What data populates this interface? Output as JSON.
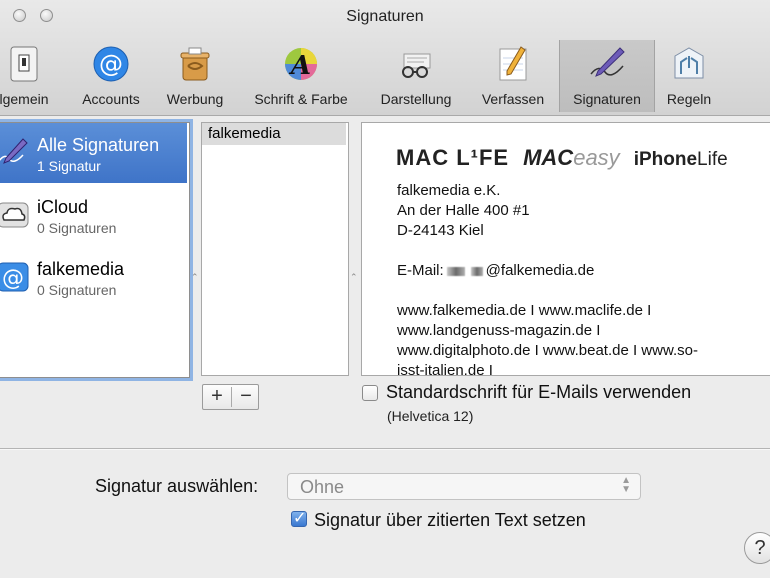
{
  "window": {
    "title": "Signaturen"
  },
  "toolbar": {
    "items": [
      {
        "label": "lgemein",
        "icon": "switch-icon"
      },
      {
        "label": "Accounts",
        "icon": "at-icon"
      },
      {
        "label": "Werbung",
        "icon": "trash-bin-icon"
      },
      {
        "label": "Schrift & Farbe",
        "icon": "font-color-icon"
      },
      {
        "label": "Darstellung",
        "icon": "glasses-icon"
      },
      {
        "label": "Verfassen",
        "icon": "pencil-note-icon"
      },
      {
        "label": "Signaturen",
        "icon": "signature-pen-icon"
      },
      {
        "label": "Regeln",
        "icon": "rules-icon"
      }
    ],
    "selected": "Signaturen"
  },
  "accounts": [
    {
      "name": "Alle Signaturen",
      "count": "1 Signatur",
      "icon": "signature-pen-icon"
    },
    {
      "name": "iCloud",
      "count": "0 Signaturen",
      "icon": "cloud-icon"
    },
    {
      "name": "falkemedia",
      "count": "0 Signaturen",
      "icon": "at-icon"
    }
  ],
  "signatures": [
    "falkemedia"
  ],
  "preview": {
    "logo_maclife": "MAC L¹FE",
    "logo_macbold": "MAC",
    "logo_maceasy": "easy",
    "logo_iphone_bold": "iPhone",
    "logo_iphone_life": "Life",
    "line1": "falkemedia e.K.",
    "line2": "An der Halle 400 #1",
    "line3": "D-24143 Kiel",
    "email_label": "E-Mail:",
    "email_domain": "@falkemedia.de",
    "web1": "www.falkemedia.de I www.maclife.de I",
    "web2": "www.landgenuss-magazin.de I",
    "web3": "www.digitalphoto.de I www.beat.de I www.so-",
    "web4": "isst-italien.de I"
  },
  "buttons": {
    "add": "+",
    "remove": "−"
  },
  "default_font": {
    "label": "Standardschrift für E-Mails verwenden",
    "note": "(Helvetica 12)",
    "checked": false
  },
  "choose": {
    "label": "Signatur auswählen:",
    "value": "Ohne"
  },
  "above_quote": {
    "label": "Signatur über zitierten Text setzen",
    "checked": true
  },
  "help": "?"
}
